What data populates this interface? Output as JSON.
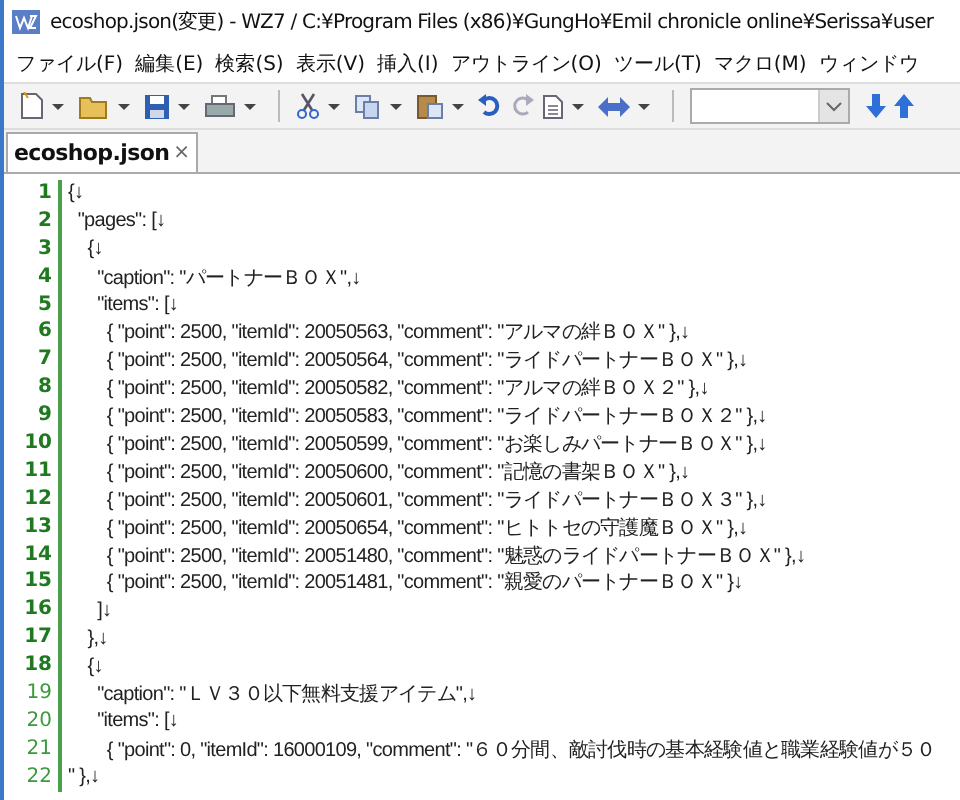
{
  "window": {
    "title": "ecoshop.json(変更) - WZ7 / C:¥Program Files (x86)¥GungHo¥Emil chronicle online¥Serissa¥user"
  },
  "menu": [
    "ファイル(F)",
    "編集(E)",
    "検索(S)",
    "表示(V)",
    "挿入(I)",
    "アウトライン(O)",
    "ツール(T)",
    "マクロ(M)",
    "ウィンドウ"
  ],
  "tabs": [
    {
      "label": "ecoshop.json",
      "close": "×",
      "selected": true
    }
  ],
  "editor": {
    "lines": [
      {
        "number": "1",
        "modified": true,
        "text": "{↓"
      },
      {
        "number": "2",
        "modified": true,
        "text": "  \"pages\": [↓"
      },
      {
        "number": "3",
        "modified": true,
        "text": "    {↓"
      },
      {
        "number": "4",
        "modified": true,
        "text": "      \"caption\": \"パートナーＢＯＸ\",↓"
      },
      {
        "number": "5",
        "modified": true,
        "text": "      \"items\": [↓"
      },
      {
        "number": "6",
        "modified": true,
        "text": "        { \"point\": 2500, \"itemId\": 20050563, \"comment\": \"アルマの絆ＢＯＸ\" },↓"
      },
      {
        "number": "7",
        "modified": true,
        "text": "        { \"point\": 2500, \"itemId\": 20050564, \"comment\": \"ライドパートナーＢＯＸ\" },↓"
      },
      {
        "number": "8",
        "modified": true,
        "text": "        { \"point\": 2500, \"itemId\": 20050582, \"comment\": \"アルマの絆ＢＯＸ２\" },↓"
      },
      {
        "number": "9",
        "modified": true,
        "text": "        { \"point\": 2500, \"itemId\": 20050583, \"comment\": \"ライドパートナーＢＯＸ２\" },↓"
      },
      {
        "number": "10",
        "modified": true,
        "text": "        { \"point\": 2500, \"itemId\": 20050599, \"comment\": \"お楽しみパートナーＢＯＸ\" },↓"
      },
      {
        "number": "11",
        "modified": true,
        "text": "        { \"point\": 2500, \"itemId\": 20050600, \"comment\": \"記憶の書架ＢＯＸ\" },↓"
      },
      {
        "number": "12",
        "modified": true,
        "text": "        { \"point\": 2500, \"itemId\": 20050601, \"comment\": \"ライドパートナーＢＯＸ３\" },↓"
      },
      {
        "number": "13",
        "modified": true,
        "text": "        { \"point\": 2500, \"itemId\": 20050654, \"comment\": \"ヒトトセの守護魔ＢＯＸ\" },↓"
      },
      {
        "number": "14",
        "modified": true,
        "text": "        { \"point\": 2500, \"itemId\": 20051480, \"comment\": \"魅惑のライドパートナーＢＯＸ\" },↓"
      },
      {
        "number": "15",
        "modified": true,
        "text": "        { \"point\": 2500, \"itemId\": 20051481, \"comment\": \"親愛のパートナーＢＯＸ\" }↓"
      },
      {
        "number": "16",
        "modified": true,
        "text": "      ]↓"
      },
      {
        "number": "17",
        "modified": true,
        "text": "    },↓"
      },
      {
        "number": "18",
        "modified": true,
        "text": "    {↓"
      },
      {
        "number": "19",
        "modified": false,
        "text": "      \"caption\": \"ＬＶ３０以下無料支援アイテム\",↓"
      },
      {
        "number": "20",
        "modified": false,
        "text": "      \"items\": [↓"
      },
      {
        "number": "21",
        "modified": false,
        "text": "        { \"point\": 0, \"itemId\": 16000109, \"comment\": \"６０分間、敵討伐時の基本経験値と職業経験値が５０"
      },
      {
        "number": "22",
        "modified": false,
        "text": "\" },↓"
      }
    ]
  }
}
